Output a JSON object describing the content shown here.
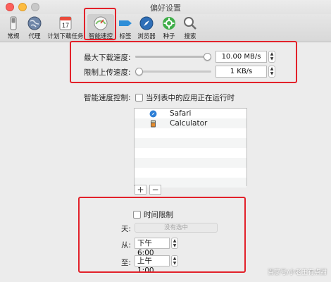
{
  "window": {
    "title": "偏好设置"
  },
  "toolbar": {
    "items": [
      {
        "label": "常规",
        "icon": "switch-icon"
      },
      {
        "label": "代理",
        "icon": "globe-icon"
      },
      {
        "label": "计划下载任务",
        "icon": "calendar-icon",
        "badge": "17"
      },
      {
        "label": "智能速控",
        "icon": "speedometer-icon",
        "selected": true
      },
      {
        "label": "标签",
        "icon": "tag-icon"
      },
      {
        "label": "浏览器",
        "icon": "compass-icon"
      },
      {
        "label": "种子",
        "icon": "gear-icon"
      },
      {
        "label": "搜索",
        "icon": "magnifier-icon"
      }
    ]
  },
  "speed": {
    "max_download_label": "最大下载速度:",
    "max_download_value": "10.00 MB/s",
    "max_download_level": 1.0,
    "max_upload_label": "限制上传速度:",
    "max_upload_value": "1 KB/s",
    "max_upload_level": 0.0
  },
  "smart_control": {
    "label": "智能速度控制:",
    "checkbox_label": "当列表中的应用正在运行时",
    "apps": [
      {
        "name": "Safari",
        "icon": "safari-icon"
      },
      {
        "name": "Calculator",
        "icon": "calculator-icon"
      }
    ],
    "add_label": "+",
    "remove_label": "−"
  },
  "schedule": {
    "checkbox_label": "时间限制",
    "day_label": "天:",
    "day_value": "没有选中",
    "from_label": "从:",
    "from_value": "下午  6:00",
    "to_label": "至:",
    "to_value": "上午  1:00"
  },
  "watermark": "百家号/小老王有点甜",
  "colors": {
    "highlight_box": "#e2212a",
    "close": "#fc605c",
    "minimize": "#fdbc40"
  }
}
